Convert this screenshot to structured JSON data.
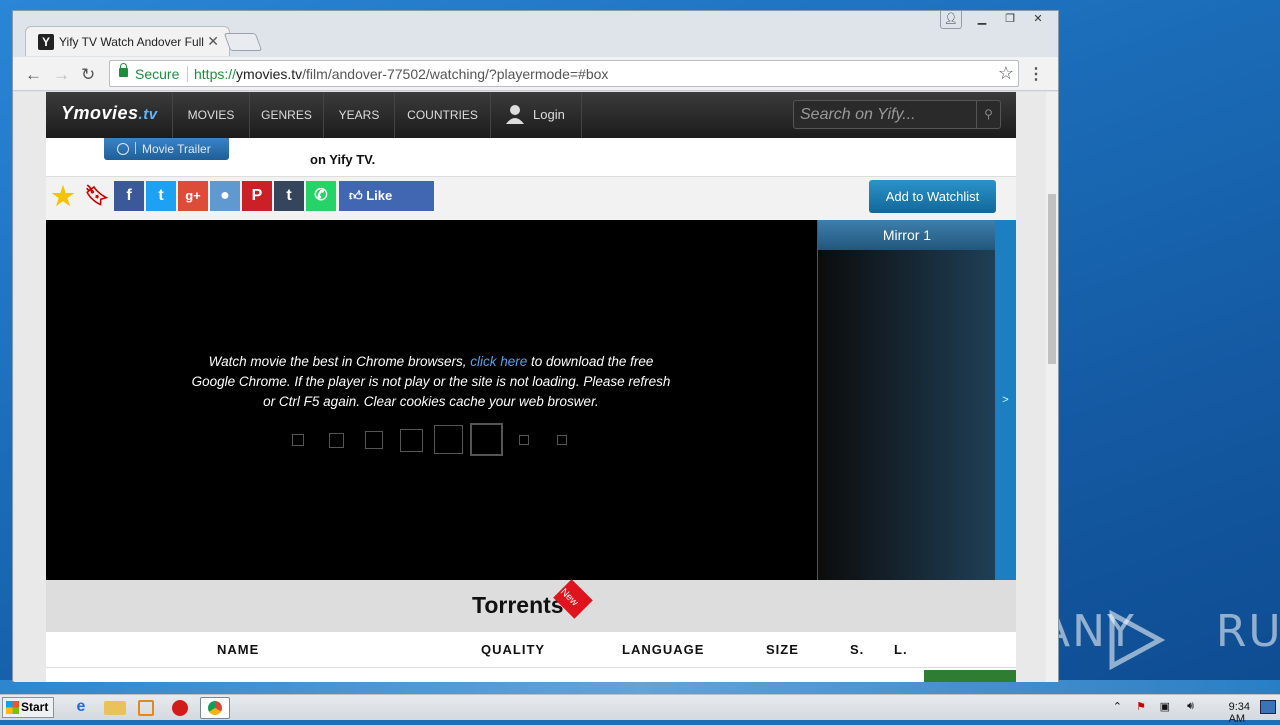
{
  "browser": {
    "tab_title": "Yify TV Watch Andover Full",
    "favicon_letter": "Y",
    "secure_label": "Secure",
    "url_scheme": "https://",
    "url_host": "ymovies.tv",
    "url_path": "/film/andover-77502/watching/?playermode=#box"
  },
  "site": {
    "logo_main": "Ymovies",
    "logo_tld": ".tv",
    "nav": [
      "MOVIES",
      "GENRES",
      "YEARS",
      "COUNTRIES"
    ],
    "login_label": "Login",
    "search_placeholder": "Search on Yify...",
    "trailer_label": "Movie Trailer",
    "desc_text": "on Yify TV.",
    "like_label": "Like",
    "watchlist_label": "Add to Watchlist",
    "player_msg_1": "Watch movie the best in Chrome browsers,",
    "player_link": "click here",
    "player_msg_2": "to download the free Google Chrome. If the player is not play or the site is not loading. Please refresh or Ctrl F5 again. Clear cookies cache your web broswer.",
    "mirror_label": "Mirror 1",
    "side_arrow": ">",
    "torrents_title": "Torrents",
    "new_badge": "New",
    "table_headers": [
      "NAME",
      "QUALITY",
      "LANGUAGE",
      "SIZE",
      "S.",
      "L."
    ]
  },
  "taskbar": {
    "start_label": "Start",
    "clock": "9:34 AM"
  },
  "watermark": "ANY RUN",
  "colors": {
    "accent_blue": "#1f6fae",
    "secure_green": "#1e8e3e",
    "badge_red": "#e0141e"
  }
}
